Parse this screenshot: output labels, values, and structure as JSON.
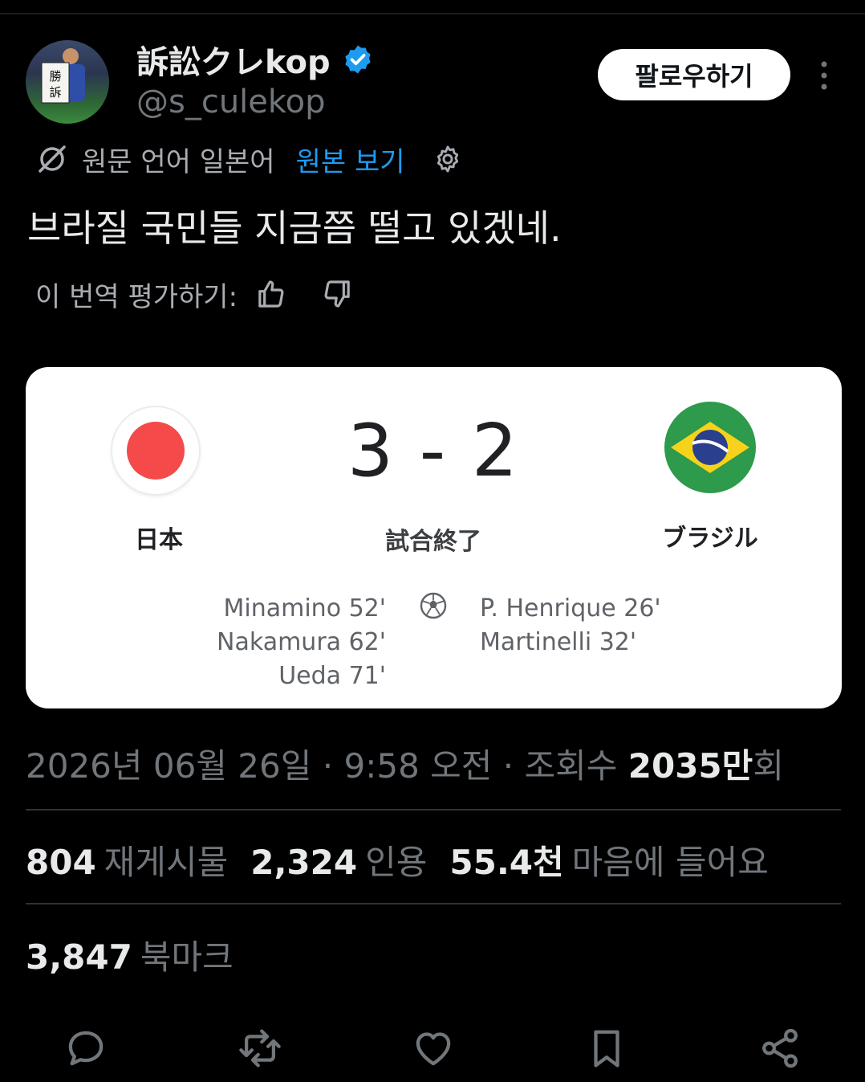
{
  "author": {
    "display_name": "訴訟クレkop",
    "handle": "@s_culekop",
    "avatar_sign_text": "勝訴"
  },
  "follow_label": "팔로우하기",
  "translation": {
    "source_label": "원문 언어 일본어",
    "view_original": "원본 보기",
    "rate_label": "이 번역 평가하기:"
  },
  "tweet_text": "브라질 국민들 지금쯤 떨고 있겠네.",
  "match": {
    "home_team": "日本",
    "away_team": "ブラジル",
    "score": "3 - 2",
    "status": "試合終了",
    "home_scorers": [
      "Minamino 52'",
      "Nakamura 62'",
      "Ueda 71'"
    ],
    "away_scorers": [
      "P.  Henrique 26'",
      "Martinelli 32'"
    ]
  },
  "meta": {
    "date": "2026년 06월 26일",
    "time": "9:58 오전",
    "views_label": "조회수",
    "views_value": "2035만",
    "views_suffix": "회"
  },
  "stats": {
    "reposts_num": "804",
    "reposts_label": "재게시물",
    "quotes_num": "2,324",
    "quotes_label": "인용",
    "likes_num": "55.4천",
    "likes_label": "마음에 들어요",
    "bookmarks_num": "3,847",
    "bookmarks_label": "북마크"
  },
  "colors": {
    "accent": "#1d9bf0",
    "background": "#000000",
    "card_background": "#ffffff",
    "japan_red": "#f44a4a",
    "brazil_green": "#2e9a4b",
    "brazil_yellow": "#f7d21b",
    "brazil_blue": "#2a3f8e"
  },
  "icons": [
    "verified-badge-icon",
    "more-icon",
    "translate-icon",
    "gear-icon",
    "thumbs-up-icon",
    "thumbs-down-icon",
    "soccer-ball-icon",
    "reply-icon",
    "repost-icon",
    "like-icon",
    "bookmark-icon",
    "share-icon"
  ]
}
